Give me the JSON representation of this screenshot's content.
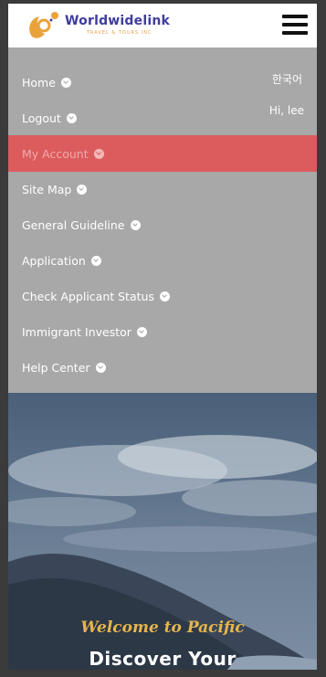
{
  "brand": {
    "name": "Worldwidelink",
    "tagline": "TRAVEL & TOURS INC"
  },
  "menu": {
    "language": "한국어",
    "greeting": "Hi, lee",
    "items": [
      {
        "label": "Home"
      },
      {
        "label": "Logout"
      },
      {
        "label": "My Account",
        "active": true
      },
      {
        "label": "Site Map"
      },
      {
        "label": "General Guideline"
      },
      {
        "label": "Application"
      },
      {
        "label": "Check Applicant Status"
      },
      {
        "label": "Immigrant Investor"
      },
      {
        "label": "Help Center"
      }
    ]
  },
  "hero": {
    "welcome": "Welcome to Pacific",
    "headline": "Discover Your"
  },
  "colors": {
    "menu_bg": "#a8a8a8",
    "active_bg": "#dc5c5e",
    "brand_text": "#3f3c9c",
    "brand_accent": "#e4a043",
    "welcome_text": "#e6b54c"
  },
  "icons": {
    "menu": "hamburger-icon",
    "item_chevron": "chevron-down-circle-icon"
  }
}
